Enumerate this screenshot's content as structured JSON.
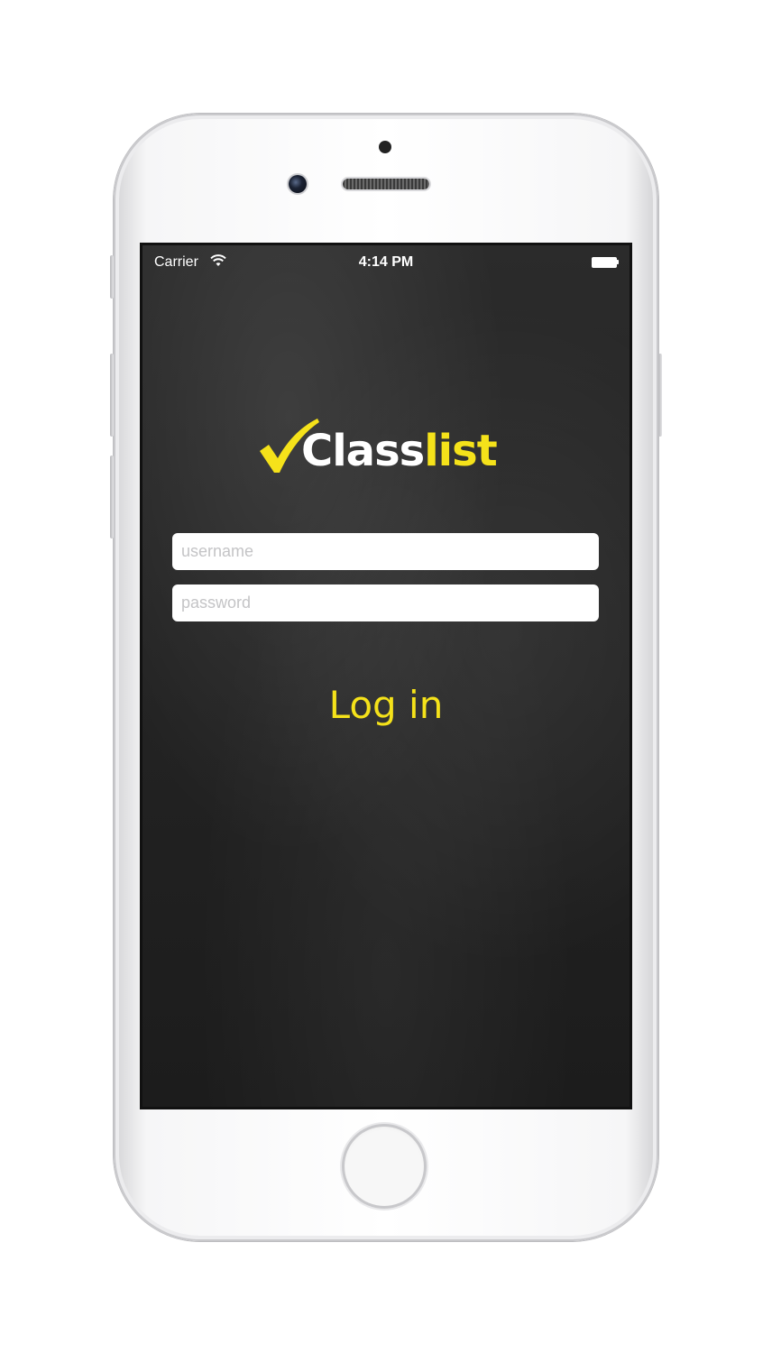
{
  "status_bar": {
    "carrier": "Carrier",
    "time": "4:14 PM",
    "wifi_icon": "wifi-icon",
    "battery_icon": "battery-icon"
  },
  "logo": {
    "part1": "Class",
    "part2": "list",
    "check_icon": "checkmark-icon"
  },
  "form": {
    "username_placeholder": "username",
    "password_placeholder": "password",
    "login_label": "Log in"
  },
  "colors": {
    "accent": "#f5e21a",
    "background": "#262626",
    "field": "#ffffff"
  }
}
